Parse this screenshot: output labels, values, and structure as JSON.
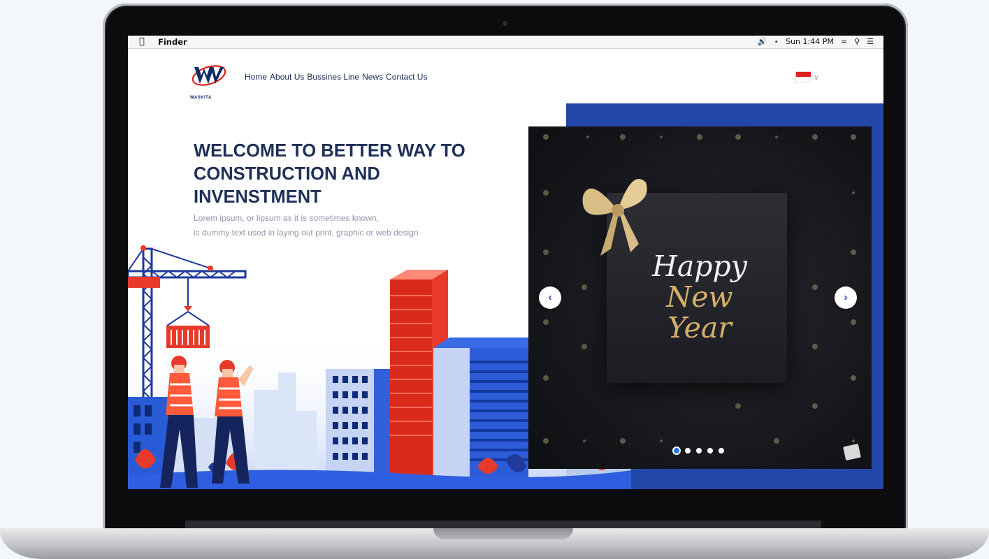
{
  "os_menubar": {
    "app_name": "Finder",
    "clock": "Sun 1:44 PM",
    "icons": [
      "apple-icon",
      "volume-icon",
      "bluetooth-icon",
      "wifi-icon",
      "search-icon",
      "list-icon"
    ]
  },
  "site": {
    "logo_text": "WASKITA",
    "nav": [
      "Home",
      "About Us",
      "Bussines Line",
      "News",
      "Contact Us"
    ],
    "language_flag": "indonesia-flag"
  },
  "hero": {
    "title": "WELCOME TO BETTER WAY TO CONSTRUCTION AND INVENSTMENT",
    "subtitle_line1": "Lorem ipsum, or lipsum as it is sometimes known,",
    "subtitle_line2": "is dummy text used in laying out print, graphic or web design"
  },
  "slider": {
    "slide_text_1": "Happy",
    "slide_text_2": "New",
    "slide_text_3": "Year",
    "prev_label": "‹",
    "next_label": "›",
    "slide_count": 5,
    "active_index": 0
  },
  "colors": {
    "brand_blue": "#2147a9",
    "title_navy": "#1e2f58",
    "accent_red": "#e83a2a"
  }
}
